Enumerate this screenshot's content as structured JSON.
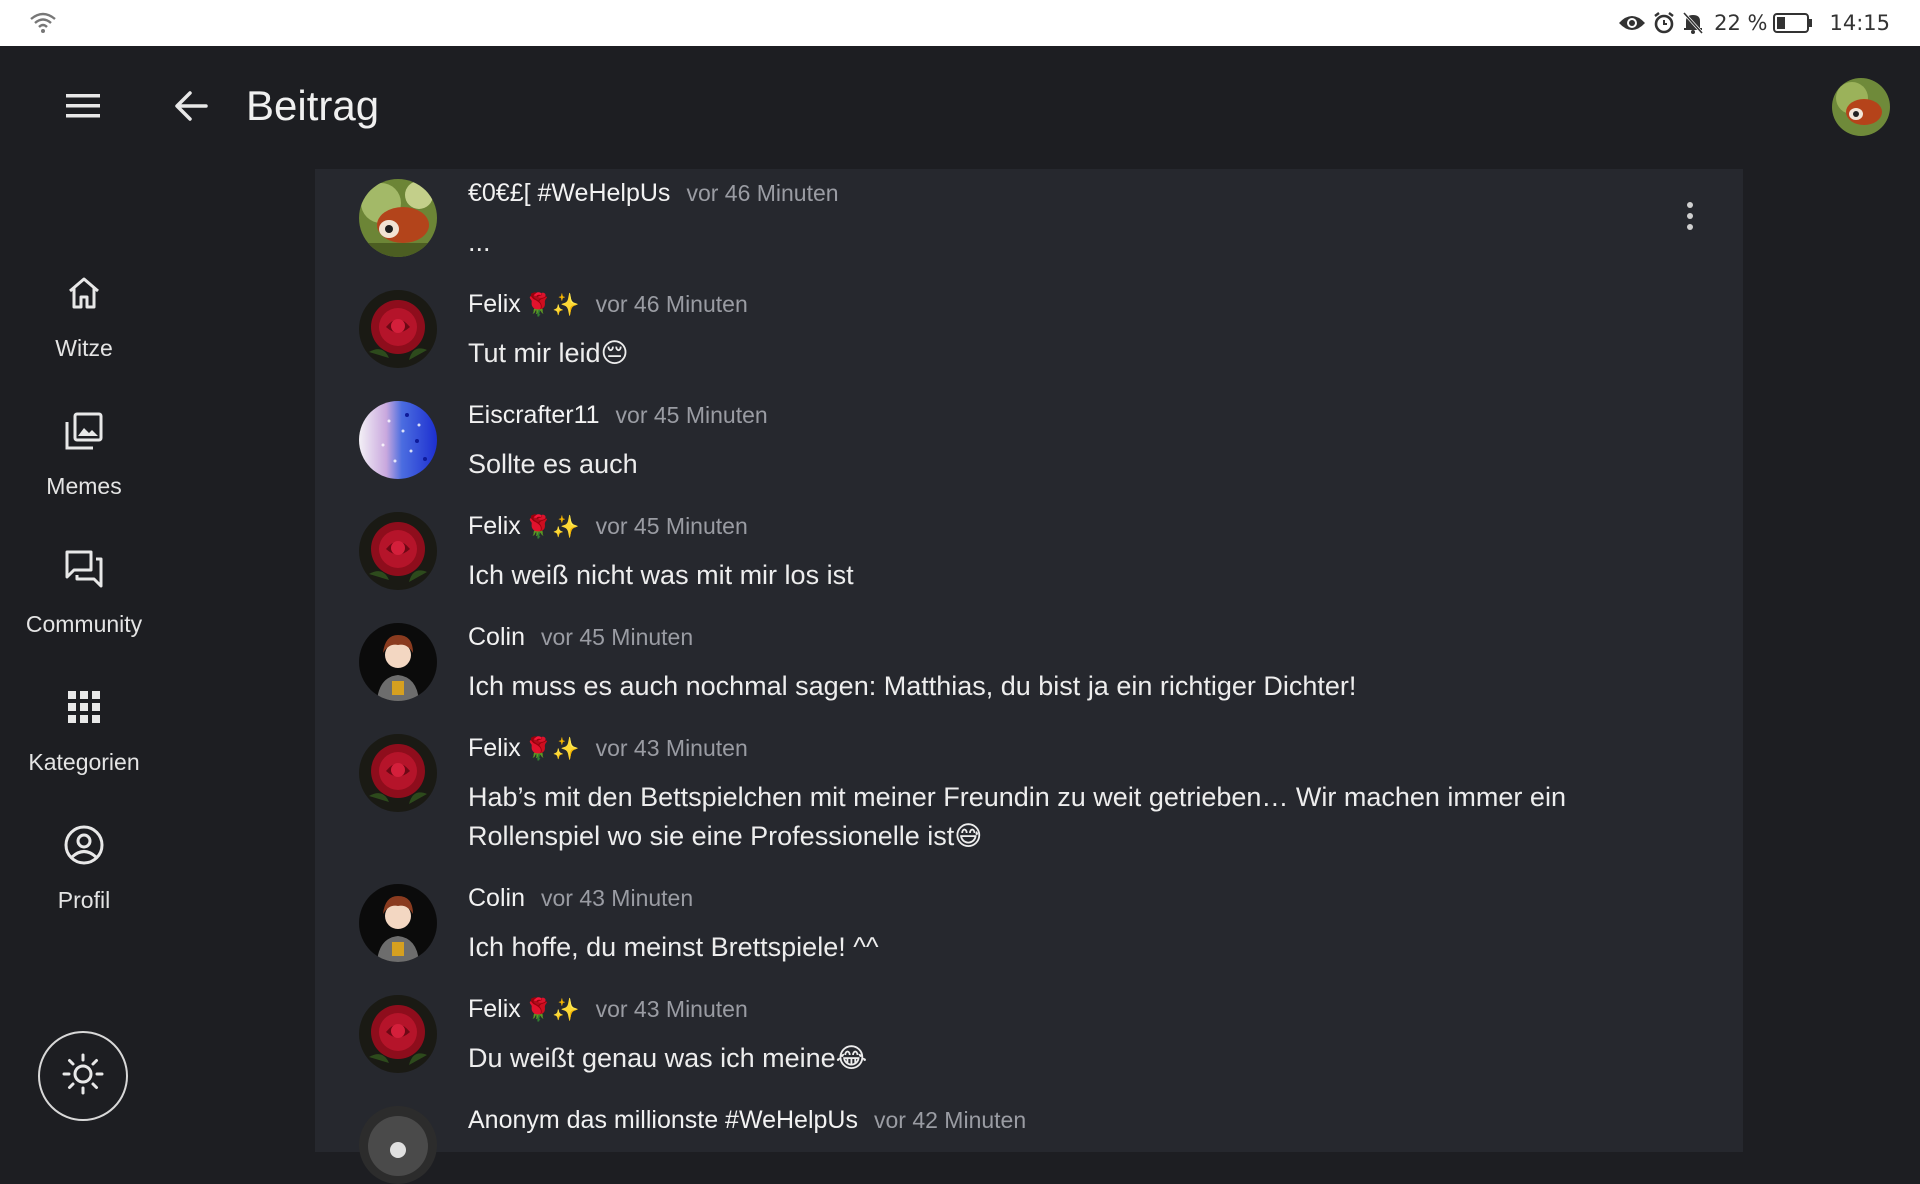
{
  "status_bar": {
    "battery_percent": "22 %",
    "time": "14:15",
    "icons": [
      "wifi-icon",
      "eye-icon",
      "alarm-icon",
      "bell-off-icon",
      "battery-icon"
    ]
  },
  "app_bar": {
    "title": "Beitrag",
    "icons": [
      "menu-icon",
      "back-arrow-icon"
    ]
  },
  "nav": {
    "items": [
      {
        "label": "Witze",
        "icon": "home-icon"
      },
      {
        "label": "Memes",
        "icon": "gallery-icon"
      },
      {
        "label": "Community",
        "icon": "forum-icon"
      },
      {
        "label": "Kategorien",
        "icon": "grid-icon"
      },
      {
        "label": "Profil",
        "icon": "account-circle-icon"
      }
    ],
    "theme_toggle_icon": "sun-icon"
  },
  "comments": [
    {
      "name": "€0€£[ #WeHelpUs",
      "emoji": "",
      "time": "vor 46 Minuten",
      "text": "...",
      "avatar": "red-panda"
    },
    {
      "name": "Felix",
      "emoji": "🌹✨",
      "time": "vor 46 Minuten",
      "text": "Tut mir leid😔",
      "avatar": "rose"
    },
    {
      "name": "Eiscrafter11",
      "emoji": "",
      "time": "vor 45 Minuten",
      "text": "Sollte es auch",
      "avatar": "glitter"
    },
    {
      "name": "Felix",
      "emoji": "🌹✨",
      "time": "vor 45 Minuten",
      "text": "Ich weiß nicht was mit mir los ist",
      "avatar": "rose"
    },
    {
      "name": "Colin",
      "emoji": "",
      "time": "vor 45 Minuten",
      "text": "Ich muss es auch nochmal sagen: Matthias, du bist ja ein richtiger Dichter!",
      "avatar": "anime"
    },
    {
      "name": "Felix",
      "emoji": "🌹✨",
      "time": "vor 43 Minuten",
      "text": "Hab’s mit den Bettspielchen mit meiner Freundin zu weit getrieben… Wir machen immer ein Rollenspiel wo sie eine Professionelle ist😅",
      "avatar": "rose"
    },
    {
      "name": "Colin",
      "emoji": "",
      "time": "vor 43 Minuten",
      "text": "Ich hoffe, du meinst Brettspiele! ^^",
      "avatar": "anime"
    },
    {
      "name": "Felix",
      "emoji": "🌹✨",
      "time": "vor 43 Minuten",
      "text": "Du weißt genau was ich meine😂",
      "avatar": "rose"
    },
    {
      "name": "Anonym das millionste #WeHelpUs",
      "emoji": "",
      "time": "vor 42 Minuten",
      "text": "",
      "avatar": "moon"
    }
  ]
}
